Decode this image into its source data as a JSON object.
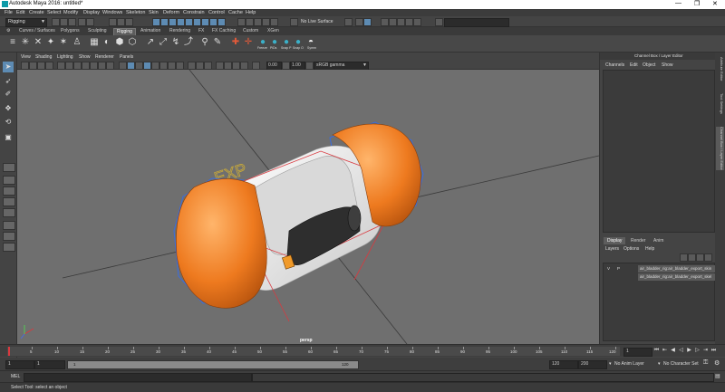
{
  "window": {
    "title": "Autodesk Maya 2016: untitled*",
    "minimize": "—",
    "maximize": "❐",
    "close": "✕"
  },
  "menubar": [
    "File",
    "Edit",
    "Create",
    "Select",
    "Modify",
    "Display",
    "Windows",
    "Skeleton",
    "Skin",
    "Deform",
    "Constrain",
    "Control",
    "Cache",
    "Help"
  ],
  "statusline": {
    "mode": "Rigging",
    "no_live_surface": "No Live Surface"
  },
  "shelf_tabs": [
    "Curves / Surfaces",
    "Polygons",
    "Sculpting",
    "Rigging",
    "Animation",
    "Rendering",
    "FX",
    "FX Caching",
    "Custom",
    "XGen"
  ],
  "shelf_active_tab": "Rigging",
  "shelf_labels": [
    "Freeze",
    "PiDs",
    "Snap P",
    "Snap O",
    "Symm"
  ],
  "panel_menu": [
    "View",
    "Shading",
    "Lighting",
    "Show",
    "Renderer",
    "Panels"
  ],
  "panel_toolbar": {
    "exposure": "0.00",
    "gamma": "1.00",
    "colorspace": "sRGB gamma"
  },
  "viewport": {
    "camera_label": "persp",
    "handle_label": "EXP"
  },
  "channel_box": {
    "title": "Channel Box / Layer Editor",
    "menu": [
      "Channels",
      "Edit",
      "Object",
      "Show"
    ]
  },
  "layer_editor": {
    "tabs": [
      "Display",
      "Render",
      "Anim"
    ],
    "active_tab": "Display",
    "menu": [
      "Layers",
      "Options",
      "Help"
    ],
    "layers": [
      {
        "v": "V",
        "p": "P",
        "name": "air_bladder_rig:air_bladder_export_skin"
      },
      {
        "v": "",
        "p": "",
        "name": "air_bladder_rig:air_bladder_export_skel"
      }
    ]
  },
  "side_tabs": [
    "Attribute Editor",
    "Tool Settings",
    "Channel Box / Layer Editor"
  ],
  "timeline": {
    "ticks": [
      "5",
      "10",
      "15",
      "20",
      "25",
      "30",
      "35",
      "40",
      "45",
      "50",
      "55",
      "60",
      "65",
      "70",
      "75",
      "80",
      "85",
      "90",
      "95",
      "100",
      "105",
      "110",
      "115",
      "120"
    ],
    "current_frame": "1"
  },
  "range": {
    "start": "1",
    "start_inner": "1",
    "range_start_label": "1",
    "range_end_label": "120",
    "end_inner": "120",
    "end": "200",
    "anim_layer": "No Anim Layer",
    "character_set": "No Character Set"
  },
  "mel": {
    "label": "MEL"
  },
  "help_line": "Select Tool: select an object"
}
